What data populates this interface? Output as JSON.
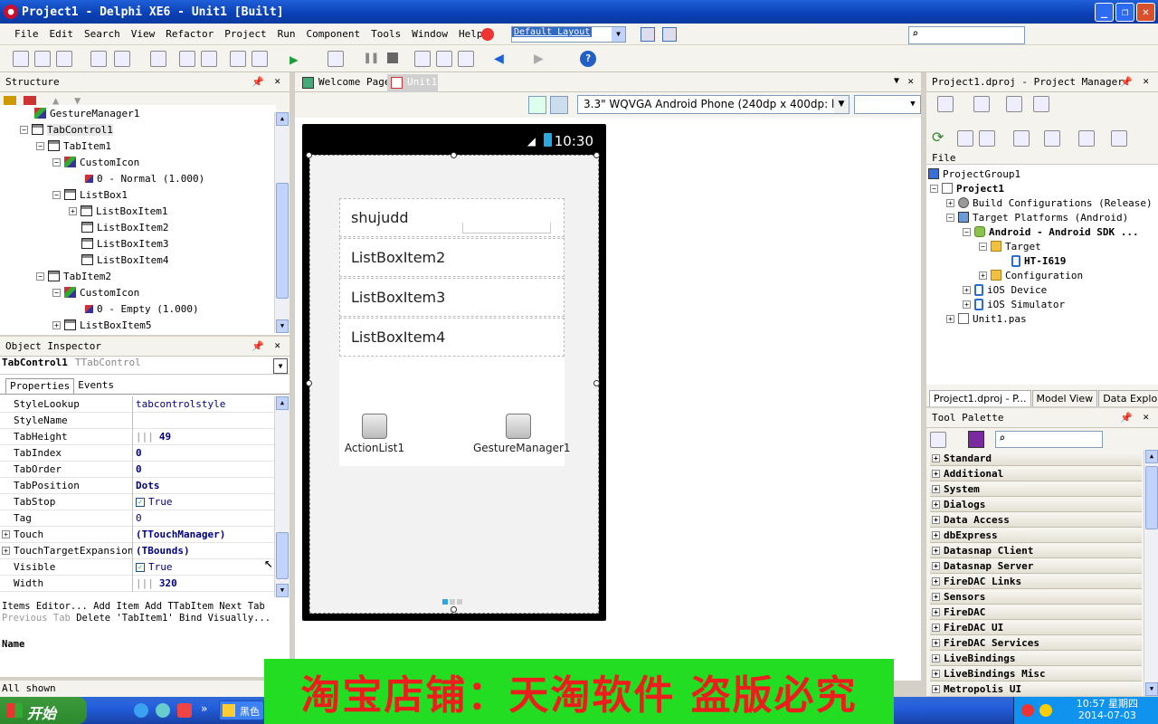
{
  "window": {
    "title": "Project1 - Delphi XE6 - Unit1 [Built]",
    "minimize": "_",
    "maximize": "❐",
    "close": "✕"
  },
  "menu": [
    "File",
    "Edit",
    "Search",
    "View",
    "Refactor",
    "Project",
    "Run",
    "Component",
    "Tools",
    "Window",
    "Help"
  ],
  "layout": {
    "selected": "Default Layout"
  },
  "structure": {
    "title": "Structure",
    "nodes": [
      "GestureManager1",
      "TabControl1",
      "TabItem1",
      "CustomIcon",
      "0 - Normal (1.000)",
      "ListBox1",
      "ListBoxItem1",
      "ListBoxItem2",
      "ListBoxItem3",
      "ListBoxItem4",
      "TabItem2",
      "CustomIcon",
      "0 - Empty (1.000)",
      "ListBoxItem5"
    ]
  },
  "object_inspector": {
    "title": "Object Inspector",
    "selected_name": "TabControl1",
    "selected_type": "TTabControl",
    "tabs": [
      "Properties",
      "Events"
    ],
    "properties": [
      {
        "name": "StyleLookup",
        "value": "tabcontrolstyle"
      },
      {
        "name": "StyleName",
        "value": ""
      },
      {
        "name": "TabHeight",
        "value": "49"
      },
      {
        "name": "TabIndex",
        "value": "0"
      },
      {
        "name": "TabOrder",
        "value": "0"
      },
      {
        "name": "TabPosition",
        "value": "Dots"
      },
      {
        "name": "TabStop",
        "value": "True"
      },
      {
        "name": "Tag",
        "value": "0"
      },
      {
        "name": "Touch",
        "value": "(TTouchManager)"
      },
      {
        "name": "TouchTargetExpansion",
        "value": "(TBounds)"
      },
      {
        "name": "Visible",
        "value": "True"
      },
      {
        "name": "Width",
        "value": "320"
      }
    ],
    "links": {
      "items_editor": "Items Editor...",
      "add_item": "Add Item",
      "add_tabitem": "Add TTabItem",
      "next_tab": "Next Tab",
      "previous_tab": "Previous Tab",
      "delete": "Delete 'TabItem1'",
      "bind": "Bind Visually..."
    },
    "name_label": "Name"
  },
  "status": {
    "text": "All shown"
  },
  "designer": {
    "tabs": [
      "Welcome Page",
      "Unit1"
    ],
    "device": "3.3\" WQVGA Android Phone (240dp x 400dp: ldpi)",
    "phone_time": "10:30",
    "list_items": [
      "shujudd",
      "ListBoxItem2",
      "ListBoxItem3",
      "ListBoxItem4"
    ],
    "components": [
      "ActionList1",
      "GestureManager1"
    ]
  },
  "project_manager": {
    "title": "Project1.dproj - Project Manager",
    "file_label": "File",
    "tree": [
      "ProjectGroup1",
      "Project1",
      "Build Configurations (Release)",
      "Target Platforms (Android)",
      "Android - Android SDK ...",
      "Target",
      "HT-I619",
      "Configuration",
      "iOS Device",
      "iOS Simulator",
      "Unit1.pas"
    ],
    "bottom_tabs": [
      "Project1.dproj - P...",
      "Model View",
      "Data Explorer"
    ]
  },
  "tool_palette": {
    "title": "Tool Palette",
    "categories": [
      "Standard",
      "Additional",
      "System",
      "Dialogs",
      "Data Access",
      "dbExpress",
      "Datasnap Client",
      "Datasnap Server",
      "FireDAC Links",
      "Sensors",
      "FireDAC",
      "FireDAC UI",
      "FireDAC Services",
      "LiveBindings",
      "LiveBindings Misc",
      "Metropolis UI"
    ]
  },
  "taskbar": {
    "start": "开始",
    "task": "黑色",
    "time": "10:57 星期四",
    "date": "2014-07-03"
  },
  "banner": {
    "text": "淘宝店铺：天淘软件 盗版必究"
  }
}
